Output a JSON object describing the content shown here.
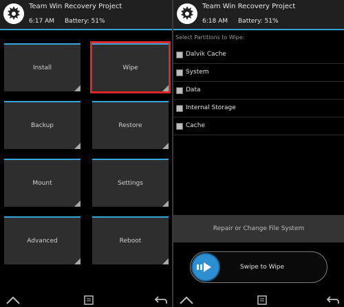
{
  "left": {
    "title": "Team Win Recovery Project",
    "time": "6:17 AM",
    "battery": "Battery: 51%",
    "tiles": [
      "Install",
      "Wipe",
      "Backup",
      "Restore",
      "Mount",
      "Settings",
      "Advanced",
      "Reboot"
    ],
    "highlighted_tile": "Wipe"
  },
  "right": {
    "title": "Team Win Recovery Project",
    "time": "6:18 AM",
    "battery": "Battery: 51%",
    "section_label": "Select Partitions to Wipe:",
    "partitions": [
      "Dalvik Cache",
      "System",
      "Data",
      "Internal Storage",
      "Cache"
    ],
    "repair_button": "Repair or Change File System",
    "swipe_label": "Swipe to Wipe"
  },
  "colors": {
    "accent": "#3aa6d8",
    "highlight": "#e0262b",
    "tile": "#2e2e2e",
    "swipe_knob": "#2c8fd1"
  },
  "icons": {
    "logo": "twrp-logo-icon",
    "home": "home-icon",
    "menu": "menu-icon",
    "back": "back-arrow-icon"
  }
}
